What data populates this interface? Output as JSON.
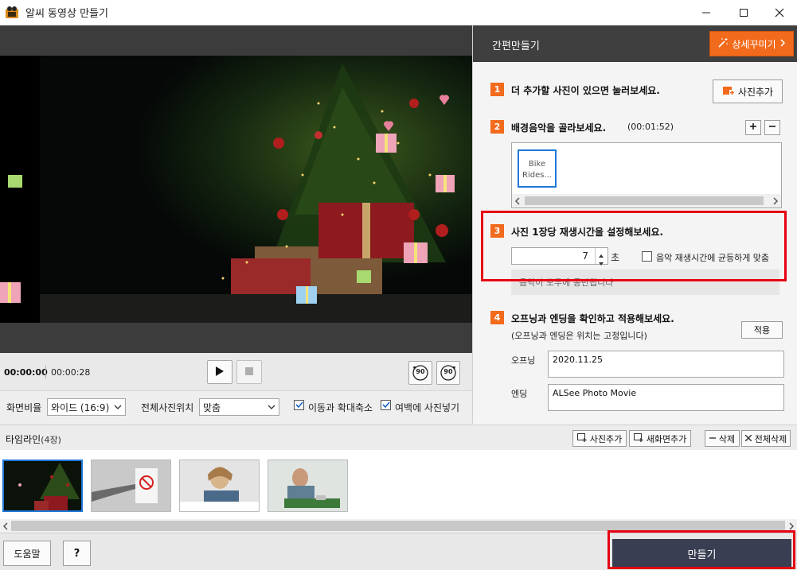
{
  "window": {
    "title": "알씨 동영상 만들기"
  },
  "player": {
    "current_time": "00:00:00",
    "total_time": "00:00:28",
    "rotate_left_label": "90",
    "rotate_right_label": "90"
  },
  "options": {
    "ratio_label": "화면비율",
    "ratio_value": "와이드 (16:9)",
    "position_label": "전체사진위치",
    "position_value": "맞춤",
    "zoom_label": "이동과 확대축소",
    "zoom_checked": true,
    "margin_label": "여백에 사진넣기",
    "margin_checked": true
  },
  "panel": {
    "title": "간편만들기",
    "detail_button": "상세꾸미기",
    "step1": {
      "num": "1",
      "text": "더 추가할 사진이 있으면 눌러보세요.",
      "button": "사진추가"
    },
    "step2": {
      "num": "2",
      "text": "배경음악을 골라보세요.",
      "duration": "(00:01:52)",
      "music_item": "Bike Rides..."
    },
    "step3": {
      "num": "3",
      "text": "사진 1장당 재생시간을 설정해보세요.",
      "value": "7",
      "unit": "초",
      "fit_label": "음악 재생시간에 균등하게 맞춤",
      "fit_checked": false,
      "info": "음악이 모두에 동반됩니다"
    },
    "step4": {
      "num": "4",
      "text": "오프닝과 엔딩을 확인하고 적용해보세요.",
      "sub": "(오프닝과 엔딩은 위치는 고정입니다)",
      "apply_button": "적용",
      "opening_label": "오프닝",
      "opening_value": "2020.11.25",
      "ending_label": "엔딩",
      "ending_value": "ALSee Photo Movie"
    }
  },
  "timeline": {
    "title": "타임라인",
    "count": "(4장)",
    "add_photo": "사진추가",
    "new_screen": "새화면추가",
    "delete": "삭제",
    "delete_all": "전체삭제"
  },
  "bottom": {
    "help": "도움말",
    "question": "?",
    "make": "만들기"
  },
  "colors": {
    "accent": "#f26b1d",
    "highlight": "#e60012",
    "selection": "#1e78d7",
    "make_button": "#3a3e52"
  }
}
